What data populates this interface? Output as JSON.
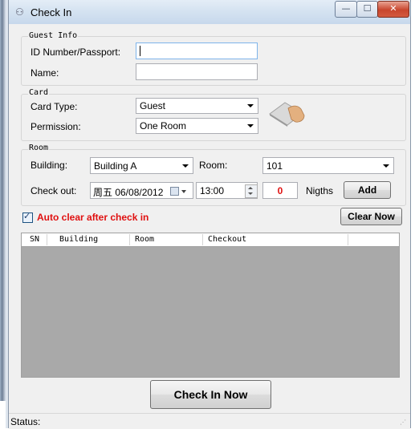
{
  "window": {
    "title": "Check In",
    "minimize_glyph": "—",
    "maximize_glyph": "☐",
    "close_glyph": "✕",
    "icon": "people-icon"
  },
  "guest_info": {
    "group_label": "Guest Info",
    "id_label": "ID Number/Passport:",
    "id_value": "",
    "name_label": "Name:",
    "name_value": ""
  },
  "card": {
    "group_label": "Card",
    "type_label": "Card Type:",
    "type_value": "Guest",
    "permission_label": "Permission:",
    "permission_value": "One Room",
    "image_icon": "card-in-hand-icon"
  },
  "room": {
    "group_label": "Room",
    "building_label": "Building:",
    "building_value": "Building A",
    "room_label": "Room:",
    "room_value": "101",
    "checkout_label": "Check out:",
    "checkout_date": "周五 06/08/2012",
    "checkout_time": "13:00",
    "nights_value": "0",
    "nights_label": "Nigths",
    "add_label": "Add"
  },
  "options": {
    "auto_clear_label": "Auto clear after check in",
    "auto_clear_checked": true,
    "clear_now_label": "Clear Now"
  },
  "table": {
    "columns": [
      "SN",
      "Building",
      "Room",
      "Checkout"
    ],
    "rows": []
  },
  "actions": {
    "check_in_label": "Check In Now"
  },
  "status": {
    "label": "Status:",
    "value": ""
  },
  "colors": {
    "accent_red": "#e01010",
    "grid_background": "#a9a9a9",
    "titlebar": "#d5e3f1"
  }
}
